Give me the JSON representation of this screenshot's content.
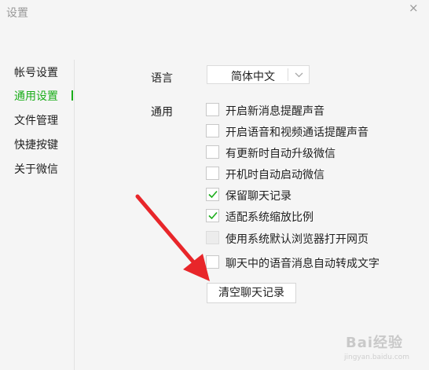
{
  "window": {
    "title": "设置",
    "close_glyph": "×"
  },
  "sidebar": {
    "items": [
      {
        "label": "帐号设置",
        "active": false
      },
      {
        "label": "通用设置",
        "active": true
      },
      {
        "label": "文件管理",
        "active": false
      },
      {
        "label": "快捷按键",
        "active": false
      },
      {
        "label": "关于微信",
        "active": false
      }
    ]
  },
  "general": {
    "language_label": "语言",
    "language_value": "简体中文",
    "general_label": "通用",
    "options": [
      {
        "label": "开启新消息提醒声音",
        "checked": false,
        "disabled": false
      },
      {
        "label": "开启语音和视频通话提醒声音",
        "checked": false,
        "disabled": false
      },
      {
        "label": "有更新时自动升级微信",
        "checked": false,
        "disabled": false
      },
      {
        "label": "开机时自动启动微信",
        "checked": false,
        "disabled": false
      },
      {
        "label": "保留聊天记录",
        "checked": true,
        "disabled": false
      },
      {
        "label": "适配系统缩放比例",
        "checked": true,
        "disabled": false
      },
      {
        "label": "使用系统默认浏览器打开网页",
        "checked": false,
        "disabled": true
      },
      {
        "label": "聊天中的语音消息自动转成文字",
        "checked": false,
        "disabled": false
      }
    ],
    "clear_button": "清空聊天记录"
  },
  "watermark": {
    "brand": "Bai经验",
    "url": "jingyan.baidu.com"
  },
  "colors": {
    "accent": "#1aad19",
    "annotation_arrow": "#e8262a"
  },
  "icons": {
    "check": "check-icon",
    "dropdown": "chevron-down-icon",
    "close": "close-icon"
  }
}
